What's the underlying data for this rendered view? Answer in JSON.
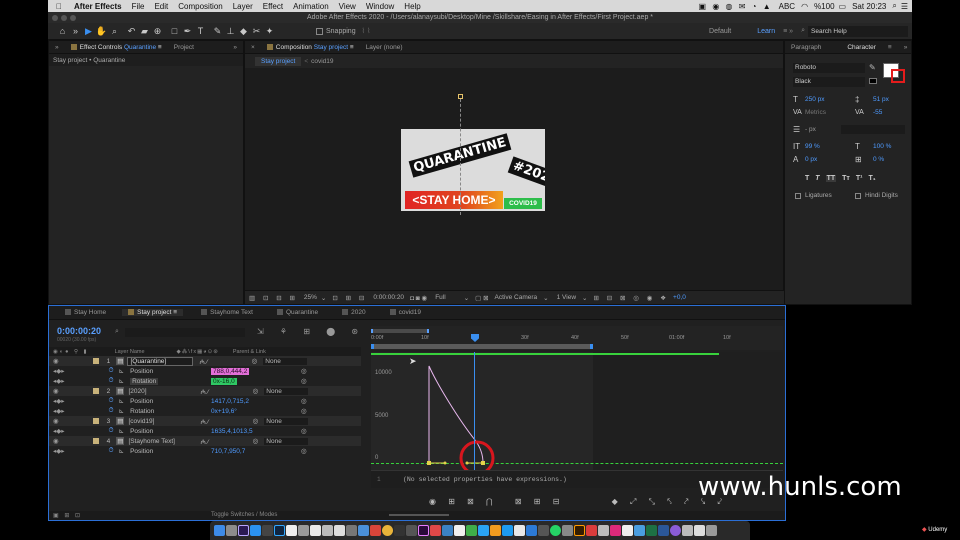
{
  "menubar": {
    "app": "After Effects",
    "items": [
      "File",
      "Edit",
      "Composition",
      "Layer",
      "Effect",
      "Animation",
      "View",
      "Window",
      "Help"
    ],
    "right": {
      "input": "ABC",
      "battery": "%100",
      "clock": "Sat 20:23"
    }
  },
  "title": "Adobe After Effects 2020 - /Users/alanaysubi/Desktop/Mine /Skillshare/Easing in After Effects/First Project.aep *",
  "toolbar": {
    "snapping": "Snapping",
    "workspace_default": "Default",
    "workspace_learn": "Learn",
    "search_placeholder": "Search Help"
  },
  "left_panel": {
    "tab_effect_prefix": "Effect Controls",
    "tab_effect_target": "Quarantine",
    "tab_project": "Project",
    "breadcrumb": "Stay project • Quarantine"
  },
  "comp_panel": {
    "tab_prefix": "Composition",
    "tab_name": "Stay project",
    "layer_tab": "Layer (none)",
    "sub_tabs": [
      "Stay project",
      "covid19"
    ],
    "artwork": {
      "quarantine": "QUARANTINE",
      "hashtag": "#2020",
      "stayhome": "<STAY HOME>",
      "covid": "COVID19"
    },
    "footer": {
      "zoom": "25%",
      "time": "0:00:00:20",
      "resolution": "Full",
      "camera": "Active Camera",
      "views": "1 View",
      "exposure": "+0,0"
    }
  },
  "right_panel": {
    "tab_paragraph": "Paragraph",
    "tab_character": "Character",
    "font": "Roboto",
    "style": "Black",
    "size": "250 px",
    "leading": "51 px",
    "kerning": "Metrics",
    "tracking": "-55",
    "stroke_units": "- px",
    "vscale": "99 %",
    "hscale": "100 %",
    "baseline": "0 px",
    "tsume": "0 %",
    "type_buttons": [
      "T",
      "T",
      "TT",
      "Tт",
      "T¹",
      "T₁"
    ],
    "ligatures": "Ligatures",
    "hindi_digits": "Hindi Digits"
  },
  "timeline": {
    "tabs": [
      "Stay Home",
      "Stay project",
      "Stayhome Text",
      "Quarantine",
      "2020",
      "covid19"
    ],
    "active_tab": 1,
    "timecode": "0:00:00:20",
    "fps": "00020 (30.00 fps)",
    "col_layer_name": "Layer Name",
    "col_parent": "Parent & Link",
    "layers": [
      {
        "num": "1",
        "name": "[Quarantine]",
        "parent": "None",
        "prop": "Position",
        "value": "788,0,444,2",
        "prop2": "Rotation",
        "value2": "0x-16,0"
      },
      {
        "num": "2",
        "name": "[2020]",
        "parent": "None",
        "prop": "Position",
        "value": "1417,0,715,2",
        "prop2": "Rotation",
        "value2": "0x+19,6°"
      },
      {
        "num": "3",
        "name": "[covid19]",
        "parent": "None",
        "prop": "Position",
        "value": "1635,4,1013,5"
      },
      {
        "num": "4",
        "name": "[Stayhome Text]",
        "parent": "None",
        "prop": "Position",
        "value": "710,7,950,7"
      }
    ],
    "ruler": [
      "0:00f",
      "10f",
      "20f",
      "30f",
      "40f",
      "50f",
      "01:00f",
      "10f"
    ],
    "graph_labels": [
      "10000",
      "5000",
      "0"
    ],
    "expression_line": "1",
    "expression_text": "(No selected properties have expressions.)",
    "footer": "Toggle Switches / Modes"
  },
  "watermark": "www.hunls.com",
  "udemy": "Udemy",
  "colors": {
    "accent_blue": "#3a8ff0",
    "graph_pink": "#e9b8ef",
    "work_area_green": "#38d13c",
    "marker_red": "#d8161e"
  }
}
